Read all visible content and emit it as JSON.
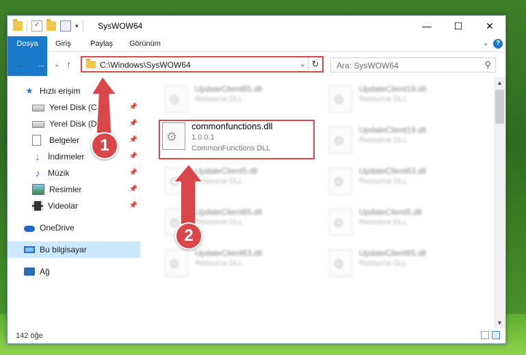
{
  "window": {
    "title": "SysWOW64",
    "controls": {
      "minimize": "—",
      "maximize": "☐",
      "close": "✕"
    }
  },
  "ribbon": {
    "tabs": [
      "Dosya",
      "Giriş",
      "Paylaş",
      "Görünüm"
    ],
    "help": "?"
  },
  "address": {
    "path": "C:\\Windows\\SysWOW64",
    "search_placeholder": "Ara: SysWOW64"
  },
  "sidebar": {
    "quick_access": "Hızlı erişim",
    "items": [
      {
        "label": "Yerel Disk (C:)",
        "icon": "drive-icon",
        "pinned": true
      },
      {
        "label": "Yerel Disk (D:)",
        "icon": "drive-icon",
        "pinned": true
      },
      {
        "label": "Belgeler",
        "icon": "documents-icon",
        "pinned": true
      },
      {
        "label": "İndirmeler",
        "icon": "downloads-icon",
        "pinned": true
      },
      {
        "label": "Müzik",
        "icon": "music-icon",
        "pinned": true
      },
      {
        "label": "Resimler",
        "icon": "pictures-icon",
        "pinned": true
      },
      {
        "label": "Videolar",
        "icon": "videos-icon",
        "pinned": true
      }
    ],
    "onedrive": "OneDrive",
    "this_pc": "Bu bilgisayar",
    "network": "Ağ"
  },
  "files": {
    "focused": {
      "name": "commonfunctions.dll",
      "version": "1.0.0.1",
      "description": "CommonFunctions DLL"
    },
    "blurred": [
      {
        "name": "UpdateClient65.dll",
        "desc": "Resource DLL"
      },
      {
        "name": "UpdateClient19.dll",
        "desc": "Resource DLL"
      },
      {
        "name": "UpdateClient19.dll",
        "desc": "Resource DLL"
      },
      {
        "name": "UpdateClient5.dll",
        "desc": "Resource DLL"
      },
      {
        "name": "UpdateClient63.dll",
        "desc": "Resource DLL"
      },
      {
        "name": "UpdateClient65.dll",
        "desc": "Resource DLL"
      },
      {
        "name": "UpdateClient5.dll",
        "desc": "Resource DLL"
      },
      {
        "name": "UpdateClient63.dll",
        "desc": "Resource DLL"
      },
      {
        "name": "UpdateClient65.dll",
        "desc": "Resource DLL"
      }
    ]
  },
  "status": {
    "count": "142 öğe"
  },
  "annotations": {
    "step1": "1",
    "step2": "2",
    "color": "#d9474a"
  }
}
